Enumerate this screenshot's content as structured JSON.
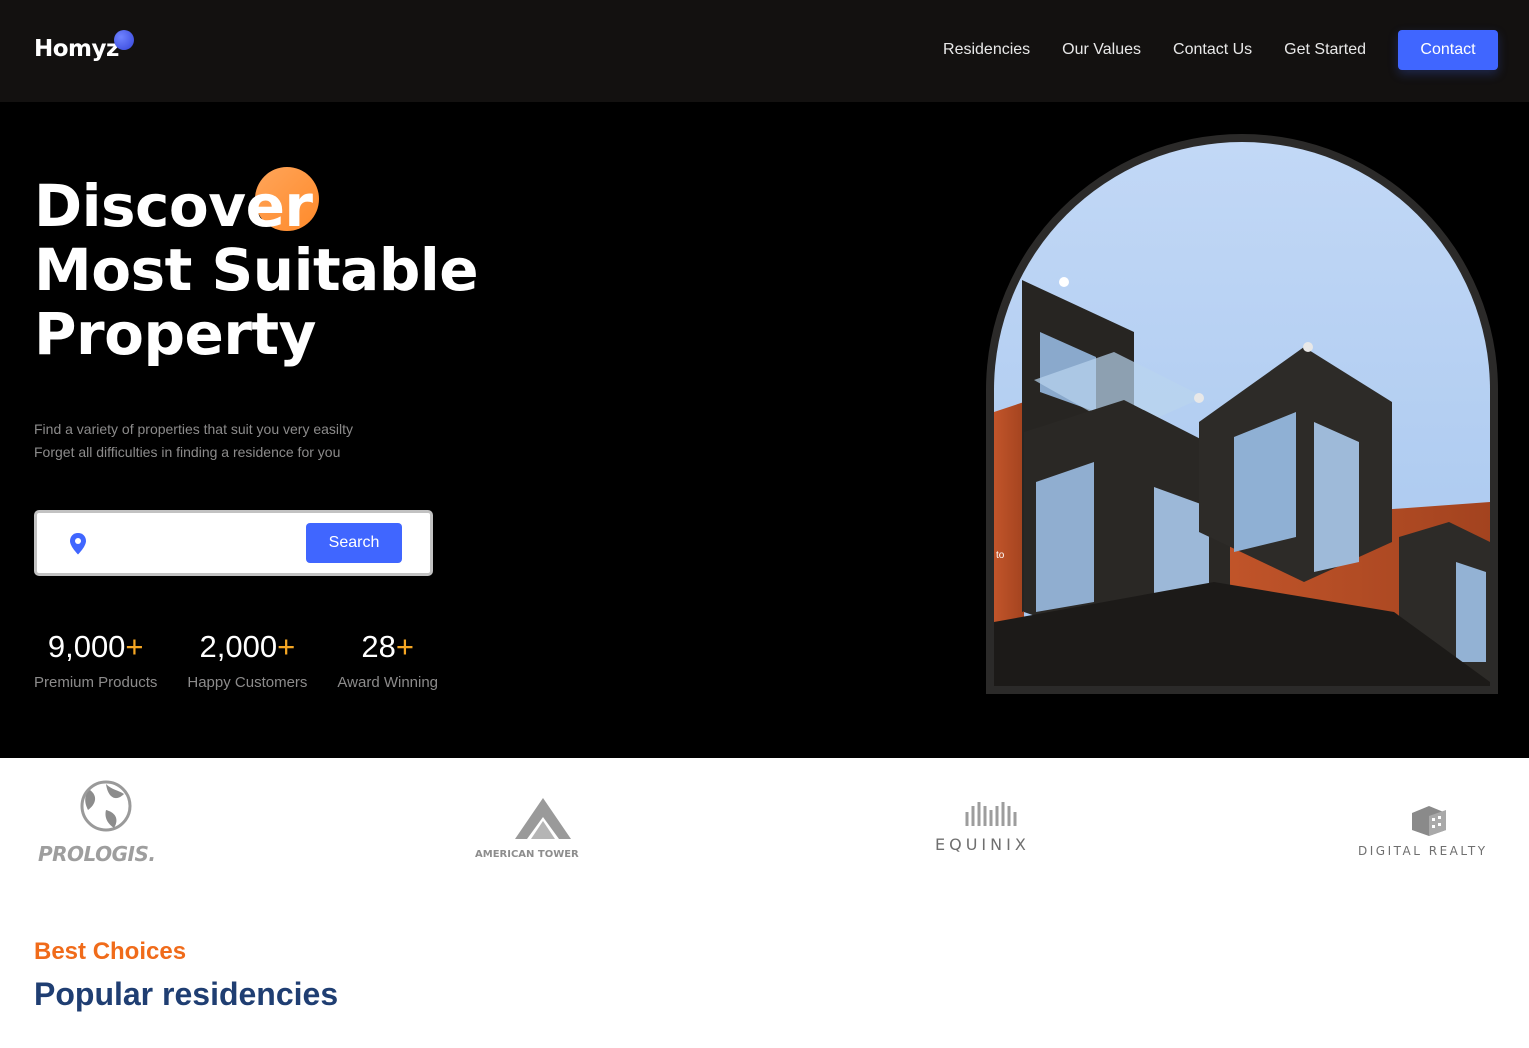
{
  "header": {
    "logo_text": "Homyz",
    "nav_links": [
      "Residencies",
      "Our Values",
      "Contact Us",
      "Get Started"
    ],
    "contact_button": "Contact"
  },
  "hero": {
    "title_lines": [
      "Discover",
      "Most Suitable",
      "Property"
    ],
    "description_lines": [
      "Find a variety of properties that suit you very easilty",
      "Forget all difficulties in finding a residence for you"
    ],
    "search": {
      "placeholder": "",
      "button": "Search"
    },
    "stats": [
      {
        "value": "9,000",
        "plus": "+",
        "label": "Premium Products"
      },
      {
        "value": "2,000",
        "plus": "+",
        "label": "Happy Customers"
      },
      {
        "value": "28",
        "plus": "+",
        "label": "Award Winning"
      }
    ],
    "image_caption": "to"
  },
  "companies": [
    {
      "name": "PROLOGIS.",
      "icon": "globe-icon"
    },
    {
      "name": "AMERICAN TOWER",
      "icon": "triangle-tower-icon"
    },
    {
      "name": "EQUINIX",
      "icon": "equinix-wave-icon"
    },
    {
      "name": "DIGITAL REALTY",
      "icon": "cube-icon"
    }
  ],
  "residencies": {
    "subtitle": "Best Choices",
    "title": "Popular residencies"
  },
  "colors": {
    "accent_blue": "#4066ff",
    "accent_orange": "#f5a623",
    "title_navy": "#1f3e72",
    "subtitle_orange": "#f06b1a"
  }
}
